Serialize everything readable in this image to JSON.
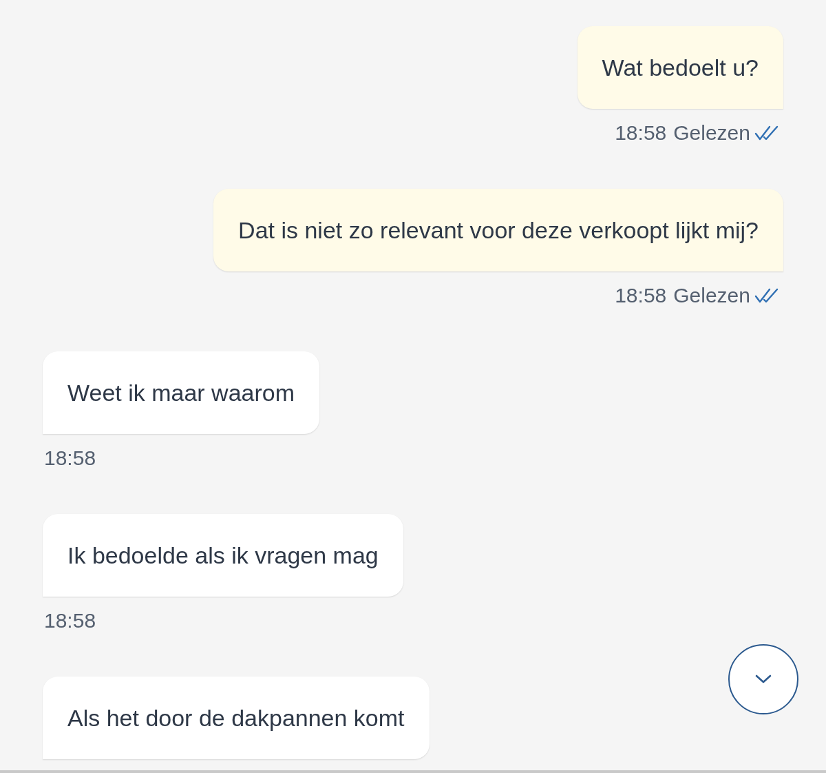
{
  "messages": [
    {
      "kind": "outgoing",
      "text": "Wat bedoelt u?",
      "time": "18:58",
      "status": "Gelezen",
      "read": true
    },
    {
      "kind": "outgoing",
      "text": "Dat is niet zo relevant voor deze verkoopt lijkt mij?",
      "time": "18:58",
      "status": "Gelezen",
      "read": true
    },
    {
      "kind": "incoming",
      "text": "Weet ik maar waarom",
      "time": "18:58"
    },
    {
      "kind": "incoming",
      "text": "Ik bedoelde als ik vragen mag",
      "time": "18:58"
    },
    {
      "kind": "incoming",
      "text": "Als het door de dakpannen komt"
    }
  ]
}
